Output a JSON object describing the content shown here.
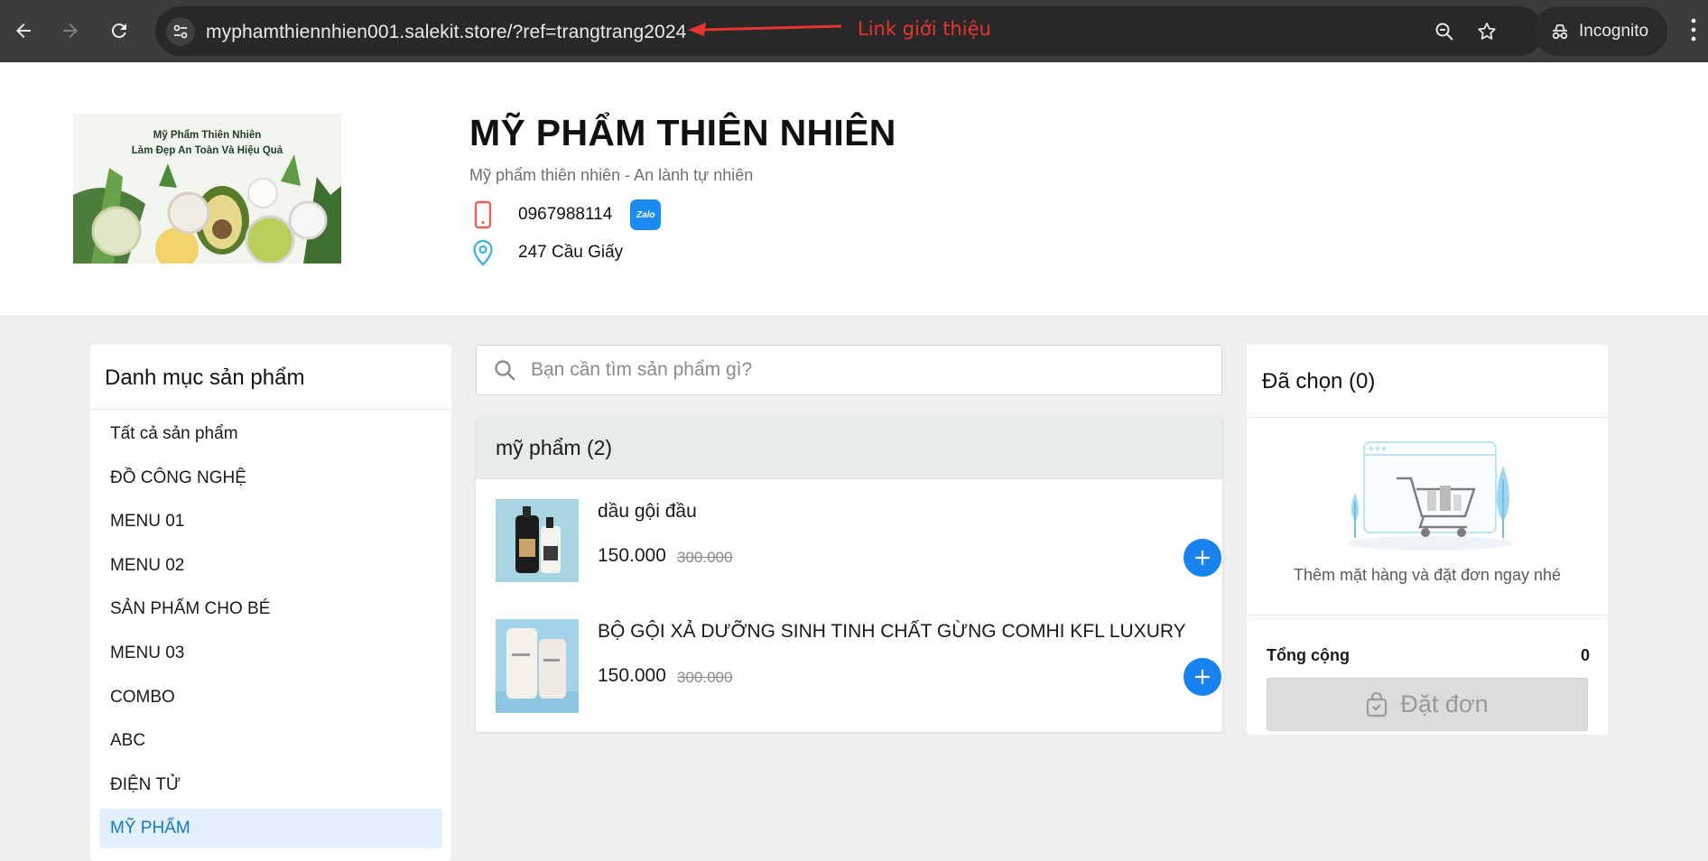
{
  "browser": {
    "url": "myphamthiennhien001.salekit.store/?ref=trangtrang2024",
    "incognito_label": "Incognito",
    "icons": [
      "back-icon",
      "forward-icon",
      "reload-icon",
      "tune-icon",
      "zoom-icon",
      "star-icon",
      "incognito-icon",
      "more-icon"
    ]
  },
  "annotation": {
    "text": "Link giới thiệu",
    "color": "#e8342f"
  },
  "store": {
    "banner_line1": "Mỹ Phẩm Thiên Nhiên",
    "banner_line2": "Làm Đẹp An Toàn Và Hiệu Quả",
    "title": "MỸ PHẨM THIÊN NHIÊN",
    "slogan": "Mỹ phẩm thiên nhiên - An lành tự nhiên",
    "phone": "0967988114",
    "zalo_label": "Zalo",
    "address": "247 Cầu Giấy"
  },
  "sidebar": {
    "title": "Danh mục sản phẩm",
    "items": [
      {
        "label": "Tất cả sản phẩm",
        "active": false
      },
      {
        "label": "ĐỒ CÔNG NGHỆ",
        "active": false
      },
      {
        "label": "MENU 01",
        "active": false
      },
      {
        "label": "MENU 02",
        "active": false
      },
      {
        "label": "SẢN PHẨM CHO BÉ",
        "active": false
      },
      {
        "label": "MENU 03",
        "active": false
      },
      {
        "label": "COMBO",
        "active": false
      },
      {
        "label": "ABC",
        "active": false
      },
      {
        "label": "ĐIỆN TỬ",
        "active": false
      },
      {
        "label": "MỸ PHẨM",
        "active": true
      }
    ]
  },
  "search": {
    "placeholder": "Bạn cần tìm sản phẩm gì?",
    "value": ""
  },
  "products": {
    "group_title": "mỹ phẩm (2)",
    "items": [
      {
        "name": "dầu gội đầu",
        "price": "150.000",
        "old_price": "300.000"
      },
      {
        "name": "BỘ GỘI XẢ DƯỠNG SINH TINH CHẤT GỪNG COMHI KFL LUXURY",
        "price": "150.000",
        "old_price": "300.000"
      }
    ]
  },
  "cart": {
    "title": "Đã chọn (0)",
    "empty_text": "Thêm mặt hàng và đặt đơn ngay nhé",
    "total_label": "Tổng cộng",
    "total_value": "0",
    "order_label": "Đặt đơn"
  },
  "colors": {
    "accent": "#1782f0",
    "active_bg": "#e2f1fd",
    "active_text": "#1677cc"
  }
}
